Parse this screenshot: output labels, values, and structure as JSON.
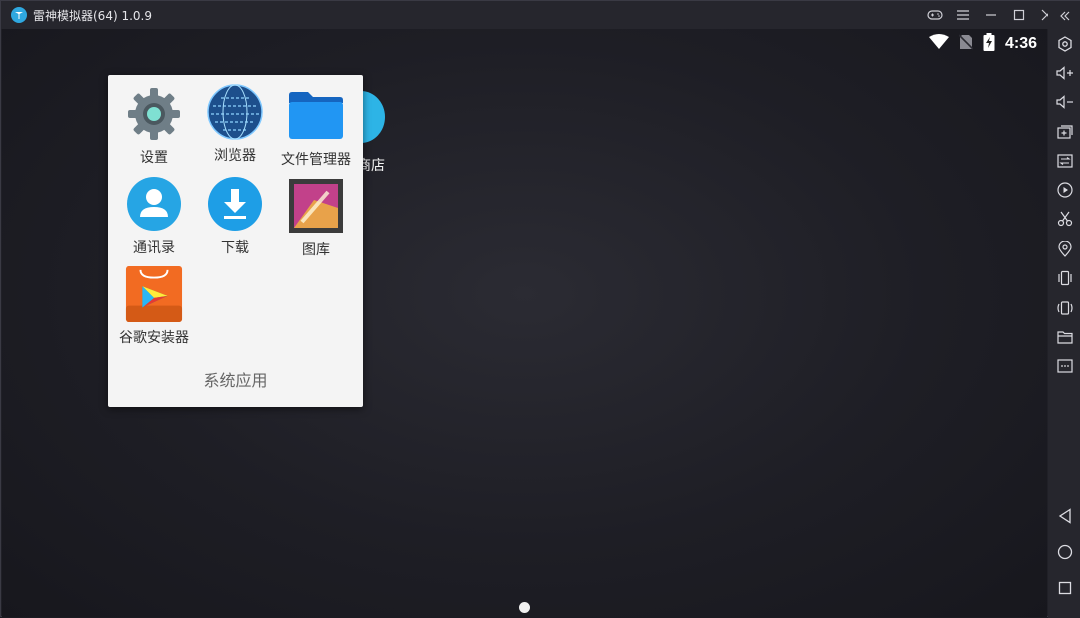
{
  "titlebar": {
    "app_title": "雷神模拟器(64) 1.0.9",
    "controls": [
      "gamepad-icon",
      "menu-icon",
      "minimize-icon",
      "maximize-icon",
      "close-icon"
    ]
  },
  "statusbar": {
    "time": "4:36",
    "icons": [
      "wifi-icon",
      "no-sim-icon",
      "battery-charging-icon"
    ]
  },
  "desktop": {
    "background_app_label": "商店"
  },
  "folder": {
    "name": "系统应用",
    "apps": [
      {
        "label": "设置",
        "icon": "settings-icon"
      },
      {
        "label": "浏览器",
        "icon": "browser-icon"
      },
      {
        "label": "文件管理器",
        "icon": "file-manager-icon"
      },
      {
        "label": "通讯录",
        "icon": "contacts-icon"
      },
      {
        "label": "下载",
        "icon": "download-icon"
      },
      {
        "label": "图库",
        "icon": "gallery-icon"
      },
      {
        "label": "谷歌安装器",
        "icon": "google-installer-icon"
      }
    ]
  },
  "sidebar": {
    "tools": [
      "collapse-icon",
      "settings-icon",
      "volume-up-icon",
      "volume-down-icon",
      "add-window-icon",
      "sync-icon",
      "play-icon",
      "scissors-icon",
      "location-icon",
      "shake-icon",
      "rotate-icon",
      "folder-icon",
      "more-icon"
    ],
    "nav": [
      "back-icon",
      "home-icon",
      "recents-icon"
    ]
  },
  "colors": {
    "accent": "#2fa8e0",
    "folder_bg": "#f4f4f4",
    "sidebar_bg": "#26262d"
  }
}
